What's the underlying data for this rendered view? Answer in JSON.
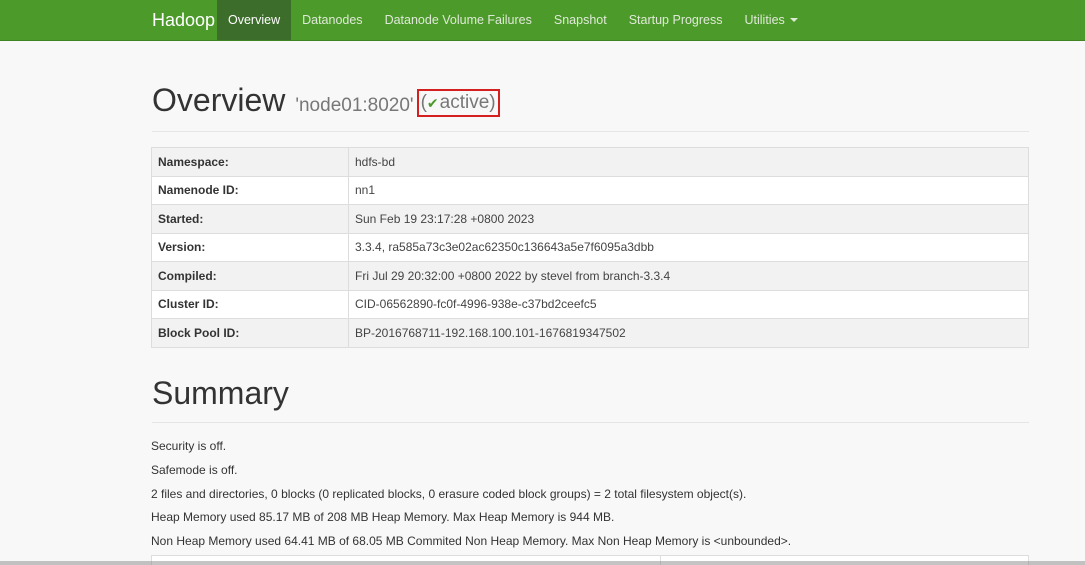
{
  "navbar": {
    "brand": "Hadoop",
    "items": [
      {
        "label": "Overview"
      },
      {
        "label": "Datanodes"
      },
      {
        "label": "Datanode Volume Failures"
      },
      {
        "label": "Snapshot"
      },
      {
        "label": "Startup Progress"
      },
      {
        "label": "Utilities"
      }
    ]
  },
  "header": {
    "title": "Overview",
    "host": "'node01:8020'",
    "status_open": "(",
    "status_icon": "check-icon",
    "status": "active",
    "status_close": ")"
  },
  "info": [
    {
      "key": "Namespace:",
      "value": "hdfs-bd"
    },
    {
      "key": "Namenode ID:",
      "value": "nn1"
    },
    {
      "key": "Started:",
      "value": "Sun Feb 19 23:17:28 +0800 2023"
    },
    {
      "key": "Version:",
      "value": "3.3.4, ra585a73c3e02ac62350c136643a5e7f6095a3dbb"
    },
    {
      "key": "Compiled:",
      "value": "Fri Jul 29 20:32:00 +0800 2022 by stevel from branch-3.3.4"
    },
    {
      "key": "Cluster ID:",
      "value": "CID-06562890-fc0f-4996-938e-c37bd2ceefc5"
    },
    {
      "key": "Block Pool ID:",
      "value": "BP-2016768711-192.168.100.101-1676819347502"
    }
  ],
  "summary": {
    "title": "Summary",
    "lines": [
      "Security is off.",
      "Safemode is off.",
      "2 files and directories, 0 blocks (0 replicated blocks, 0 erasure coded block groups) = 2 total filesystem object(s).",
      "Heap Memory used 85.17 MB of 208 MB Heap Memory. Max Heap Memory is 944 MB.",
      "Non Heap Memory used 64.41 MB of 68.05 MB Commited Non Heap Memory. Max Non Heap Memory is <unbounded>."
    ]
  },
  "colors": {
    "navbar": "#4c9a2a",
    "nav_active": "#3d6d2b",
    "highlight_box": "#d62020",
    "check": "#4c9a2a"
  }
}
